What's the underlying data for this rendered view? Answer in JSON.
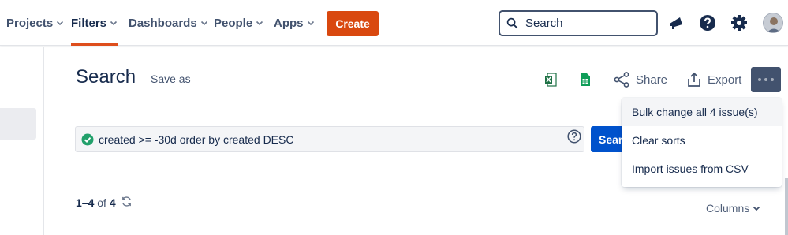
{
  "nav": {
    "items": [
      {
        "label": "Projects"
      },
      {
        "label": "Filters"
      },
      {
        "label": "Dashboards"
      },
      {
        "label": "People"
      },
      {
        "label": "Apps"
      }
    ],
    "create_label": "Create",
    "search_placeholder": "Search",
    "accent_color": "#de4e1c"
  },
  "page": {
    "title": "Search",
    "save_as_label": "Save as",
    "share_label": "Share",
    "export_label": "Export"
  },
  "jql": {
    "query": "created >= -30d order by created DESC",
    "search_button_label": "Search"
  },
  "results": {
    "range": "1–4",
    "of_label": "of",
    "total": "4",
    "columns_label": "Columns"
  },
  "more_menu": {
    "items": [
      {
        "label": "Bulk change all 4 issue(s)"
      },
      {
        "label": "Clear sorts"
      },
      {
        "label": "Import issues from CSV"
      }
    ]
  },
  "icons": {
    "excel": "excel-export-icon",
    "sheets": "google-sheets-icon",
    "share": "share-icon",
    "export": "export-icon",
    "notifications": "megaphone-icon",
    "help": "help-icon",
    "settings": "gear-icon"
  }
}
